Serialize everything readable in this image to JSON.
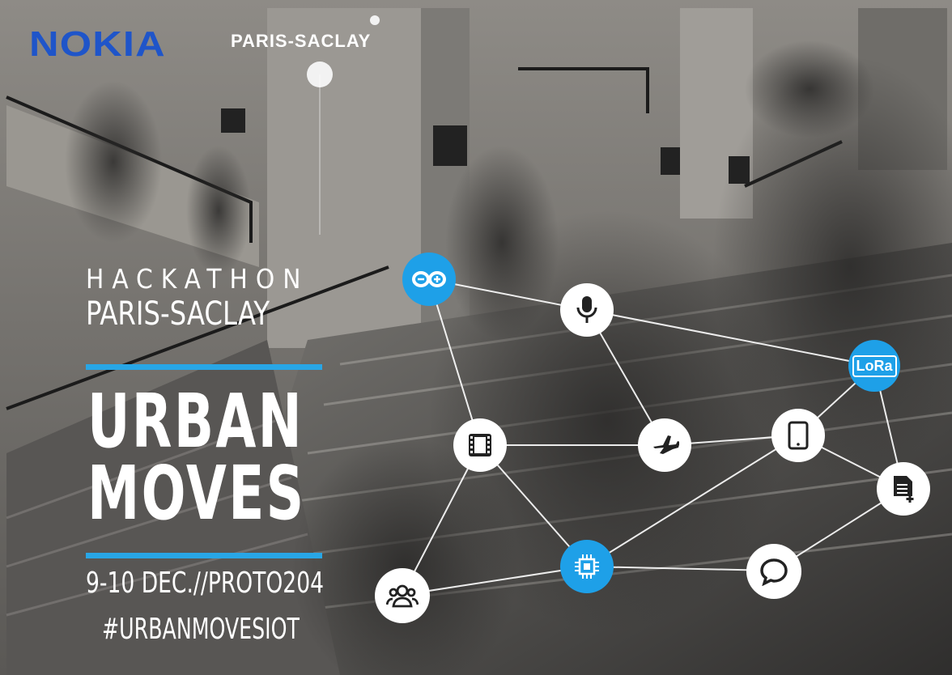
{
  "brand": {
    "nokia": "NOKIA",
    "partner": "PARIS-SACLAY"
  },
  "event": {
    "line1": "HACKATHON",
    "line2": "PARIS-SACLAY",
    "title_line1": "URBAN",
    "title_line2": "MOVES",
    "dates": "9-10 DEC.//PROTO204",
    "hashtag": "#URBANMOVESIOT"
  },
  "icons": {
    "arduino": "arduino-icon",
    "lora": "LoRa",
    "mic": "microphone-icon",
    "film": "film-icon",
    "plane": "airplane-icon",
    "tablet": "tablet-icon",
    "doc": "document-add-icon",
    "chip": "chip-icon",
    "chat": "chat-bubble-icon",
    "users": "users-icon"
  },
  "colors": {
    "accent": "#1ea0e8",
    "nokia_blue": "#1f55c9"
  }
}
